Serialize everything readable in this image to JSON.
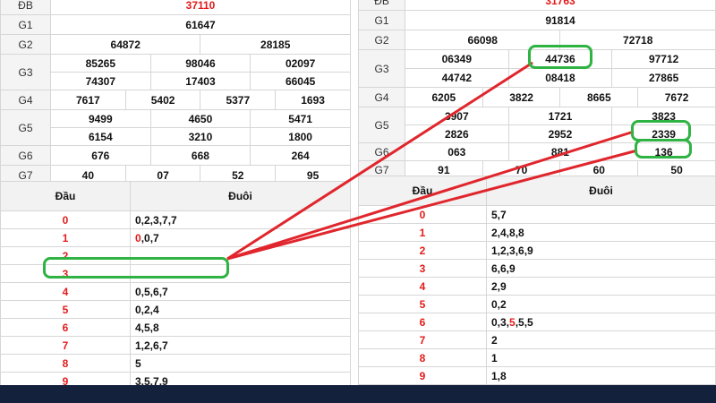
{
  "left": {
    "results": {
      "db": {
        "label": "ĐB",
        "value": "37110"
      },
      "g1": {
        "label": "G1",
        "values": [
          "61647"
        ]
      },
      "g2": {
        "label": "G2",
        "values": [
          "64872",
          "28185"
        ]
      },
      "g3": {
        "label": "G3",
        "values": [
          "85265",
          "98046",
          "02097",
          "74307",
          "17403",
          "66045"
        ]
      },
      "g4": {
        "label": "G4",
        "values": [
          "7617",
          "5402",
          "5377",
          "1693"
        ]
      },
      "g5": {
        "label": "G5",
        "values": [
          "9499",
          "4650",
          "5471",
          "6154",
          "3210",
          "1800"
        ]
      },
      "g6": {
        "label": "G6",
        "values": [
          "676",
          "668",
          "264"
        ]
      },
      "g7": {
        "label": "G7",
        "values": [
          "40",
          "07",
          "52",
          "95"
        ]
      }
    },
    "dau_duoi": {
      "head_label": "Đầu",
      "tail_label": "Đuôi",
      "rows": [
        {
          "head": "0",
          "tail": "0,2,3,7,7"
        },
        {
          "head": "1",
          "tail_red": "0",
          "tail": ",0,7"
        },
        {
          "head": "2",
          "tail": ""
        },
        {
          "head": "3",
          "tail": ""
        },
        {
          "head": "4",
          "tail": "0,5,6,7"
        },
        {
          "head": "5",
          "tail": "0,2,4"
        },
        {
          "head": "6",
          "tail": "4,5,8"
        },
        {
          "head": "7",
          "tail": "1,2,6,7"
        },
        {
          "head": "8",
          "tail": "5"
        },
        {
          "head": "9",
          "tail": "3,5,7,9"
        }
      ]
    }
  },
  "right": {
    "results": {
      "db": {
        "label": "ĐB",
        "value": "31763"
      },
      "g1": {
        "label": "G1",
        "values": [
          "91814"
        ]
      },
      "g2": {
        "label": "G2",
        "values": [
          "66098",
          "72718"
        ]
      },
      "g3": {
        "label": "G3",
        "values": [
          "06349",
          "44736",
          "97712",
          "44742",
          "08418",
          "27865"
        ]
      },
      "g4": {
        "label": "G4",
        "values": [
          "6205",
          "3822",
          "8665",
          "7672"
        ]
      },
      "g5": {
        "label": "G5",
        "values": [
          "3907",
          "1721",
          "3823",
          "2826",
          "2952",
          "2339"
        ]
      },
      "g6": {
        "label": "G6",
        "values": [
          "063",
          "881",
          "136"
        ]
      },
      "g7": {
        "label": "G7",
        "values": [
          "91",
          "70",
          "60",
          "50"
        ]
      }
    },
    "dau_duoi": {
      "head_label": "Đầu",
      "tail_label": "Đuôi",
      "rows": [
        {
          "head": "0",
          "tail": "5,7"
        },
        {
          "head": "1",
          "tail": "2,4,8,8"
        },
        {
          "head": "2",
          "tail": "1,2,3,6,9"
        },
        {
          "head": "3",
          "tail": "6,6,9"
        },
        {
          "head": "4",
          "tail": "2,9"
        },
        {
          "head": "5",
          "tail": "0,2"
        },
        {
          "head": "6",
          "tail_pre": "0,3,",
          "tail_red": "5",
          "tail": ",5,5"
        },
        {
          "head": "7",
          "tail": "2"
        },
        {
          "head": "8",
          "tail": "1"
        },
        {
          "head": "9",
          "tail": "1,8"
        }
      ]
    }
  },
  "colors": {
    "highlight": "#2fb343",
    "arrow": "#e0262c",
    "head": "#e31b1b",
    "footer": "#14213d"
  }
}
